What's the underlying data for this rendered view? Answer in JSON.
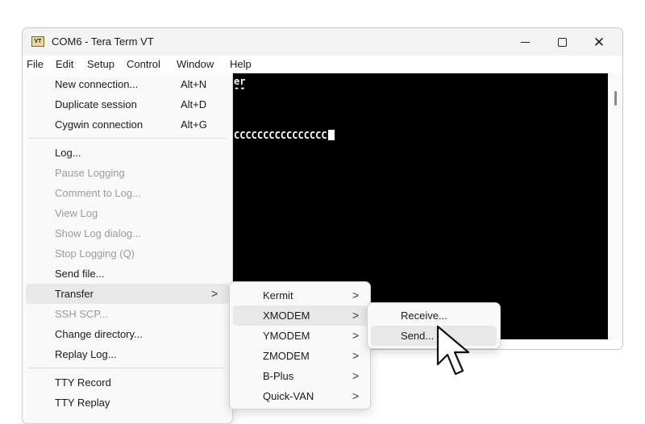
{
  "window": {
    "icon_text": "VT",
    "title": "COM6 - Tera Term VT",
    "controls": {
      "minimize": "minimize-icon",
      "maximize": "maximize-icon",
      "close": "✕"
    }
  },
  "menubar": {
    "items": [
      "File",
      "Edit",
      "Setup",
      "Control",
      "Window",
      "Help"
    ]
  },
  "terminal": {
    "lines": [
      "er",
      "--",
      "CCCCCCCCCCCCCCCC"
    ]
  },
  "file_menu": {
    "items": [
      {
        "label": "New connection...",
        "shortcut": "Alt+N"
      },
      {
        "label": "Duplicate session",
        "shortcut": "Alt+D"
      },
      {
        "label": "Cygwin connection",
        "shortcut": "Alt+G"
      },
      {
        "label": "Log..."
      },
      {
        "label": "Pause Logging",
        "disabled": true
      },
      {
        "label": "Comment to Log...",
        "disabled": true
      },
      {
        "label": "View Log",
        "disabled": true
      },
      {
        "label": "Show Log dialog...",
        "disabled": true
      },
      {
        "label": "Stop Logging (Q)",
        "disabled": true
      },
      {
        "label": "Send file..."
      },
      {
        "label": "Transfer",
        "submenu_arrow": ">"
      },
      {
        "label": "SSH SCP...",
        "disabled": true
      },
      {
        "label": "Change directory..."
      },
      {
        "label": "Replay Log..."
      },
      {
        "label": "TTY Record"
      },
      {
        "label": "TTY Replay"
      }
    ]
  },
  "transfer_menu": {
    "items": [
      {
        "label": "Kermit",
        "arrow": ">"
      },
      {
        "label": "XMODEM",
        "arrow": ">"
      },
      {
        "label": "YMODEM",
        "arrow": ">"
      },
      {
        "label": "ZMODEM",
        "arrow": ">"
      },
      {
        "label": "B-Plus",
        "arrow": ">"
      },
      {
        "label": "Quick-VAN",
        "arrow": ">"
      }
    ]
  },
  "xmodem_menu": {
    "items": [
      {
        "label": "Receive..."
      },
      {
        "label": "Send..."
      }
    ]
  },
  "colors": {
    "terminal_bg": "#000000",
    "terminal_fg": "#ffffff",
    "menu_bg": "#f9f9f9",
    "highlight": "#e8e8e8",
    "disabled_text": "#9a9a9a"
  },
  "pointer": "mouse-pointer-icon"
}
